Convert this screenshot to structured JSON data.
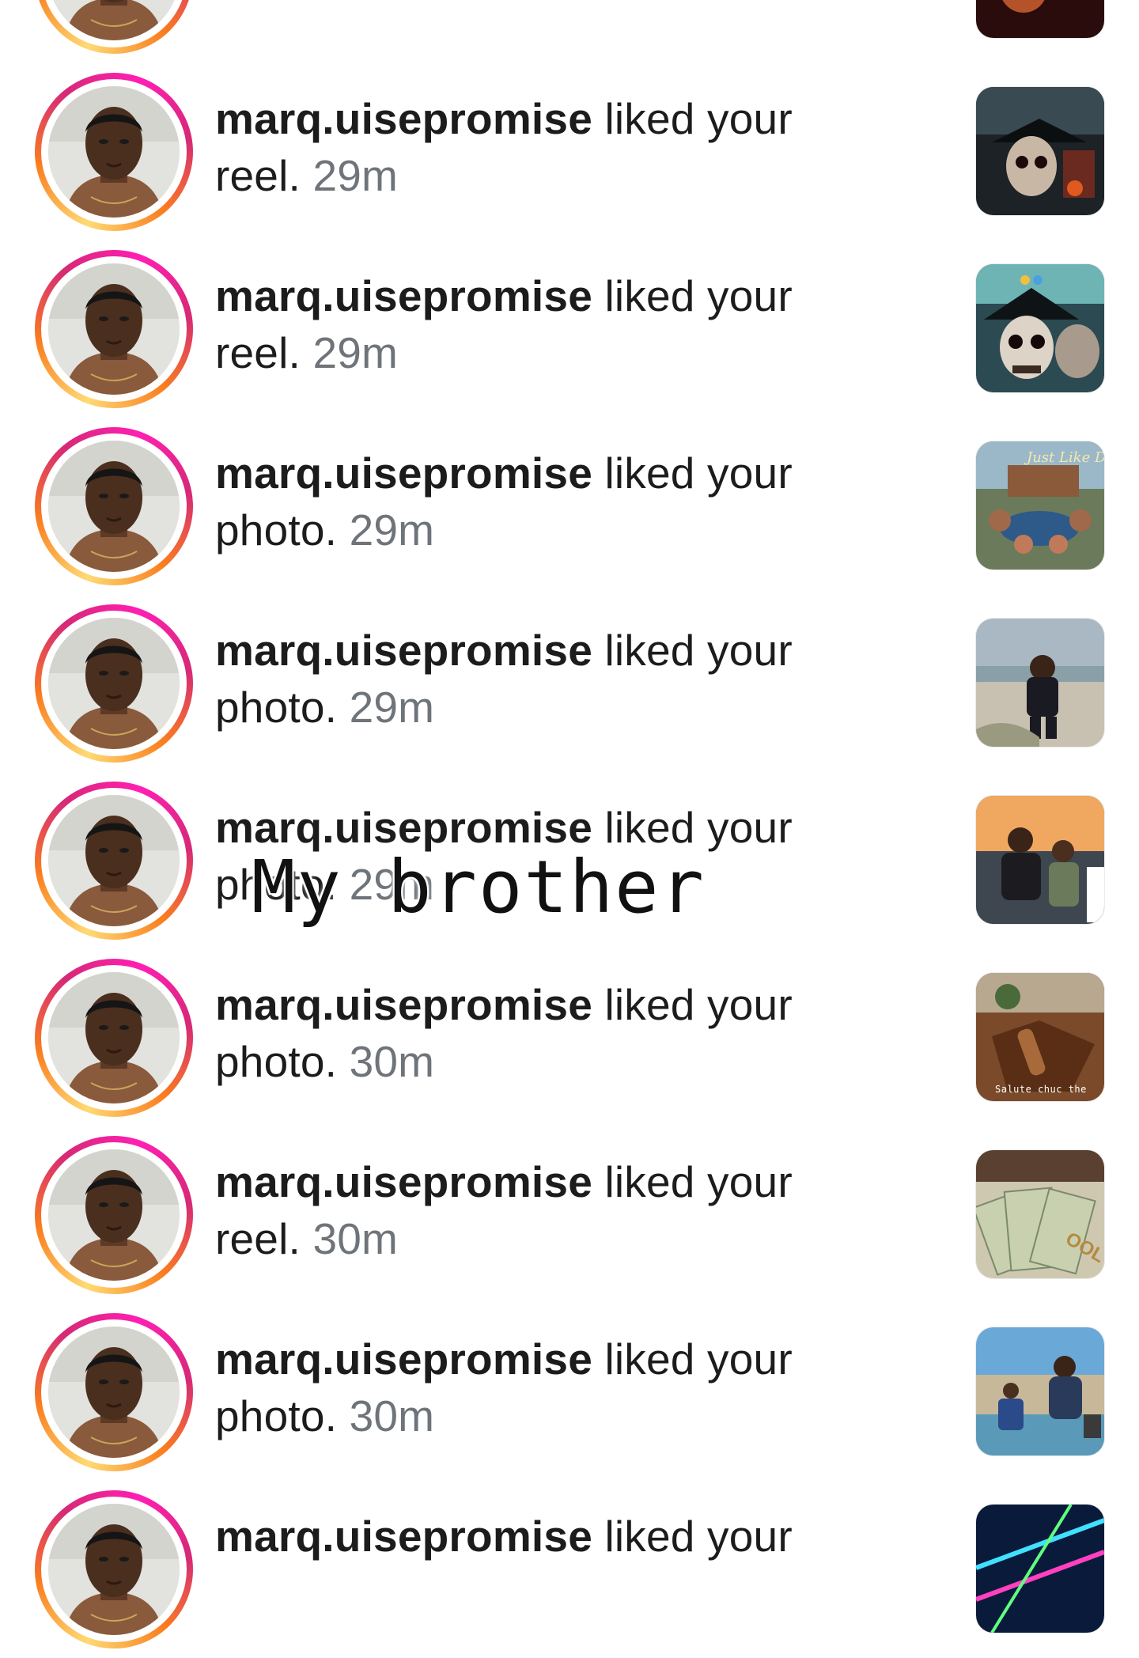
{
  "notifications": [
    {
      "username": "",
      "action": "",
      "time": "",
      "thumb_theme": "dark-red"
    },
    {
      "username": "marq.uisepromise",
      "action": " liked your reel.",
      "time": "29m",
      "thumb_theme": "dark-skull"
    },
    {
      "username": "marq.uisepromise",
      "action": " liked your reel.",
      "time": "29m",
      "thumb_theme": "teal-skull"
    },
    {
      "username": "marq.uisepromise",
      "action": " liked your photo.",
      "time": "29m",
      "thumb_theme": "album-art"
    },
    {
      "username": "marq.uisepromise",
      "action": " liked your photo.",
      "time": "29m",
      "thumb_theme": "beach"
    },
    {
      "username": "marq.uisepromise",
      "action": " liked your photo.",
      "time": "29m",
      "thumb_theme": "street"
    },
    {
      "username": "marq.uisepromise",
      "action": " liked your photo.",
      "time": "30m",
      "thumb_theme": "wood",
      "thumb_caption": "Salute chuc the"
    },
    {
      "username": "marq.uisepromise",
      "action": " liked your reel.",
      "time": "30m",
      "thumb_theme": "money"
    },
    {
      "username": "marq.uisepromise",
      "action": " liked your photo.",
      "time": "30m",
      "thumb_theme": "boat"
    },
    {
      "username": "marq.uisepromise",
      "action": " liked your",
      "time": "",
      "thumb_theme": "neon"
    }
  ],
  "overlay_caption": "My brother",
  "colors": {
    "text": "#1c1c1c",
    "timestamp": "#6e7479",
    "story_ring": [
      "#feda75",
      "#fa7e1e",
      "#d62976",
      "#ff1fb4"
    ]
  },
  "icons": {
    "avatar": "profile-photo-icon",
    "thumbnail": "post-thumbnail-icon"
  }
}
